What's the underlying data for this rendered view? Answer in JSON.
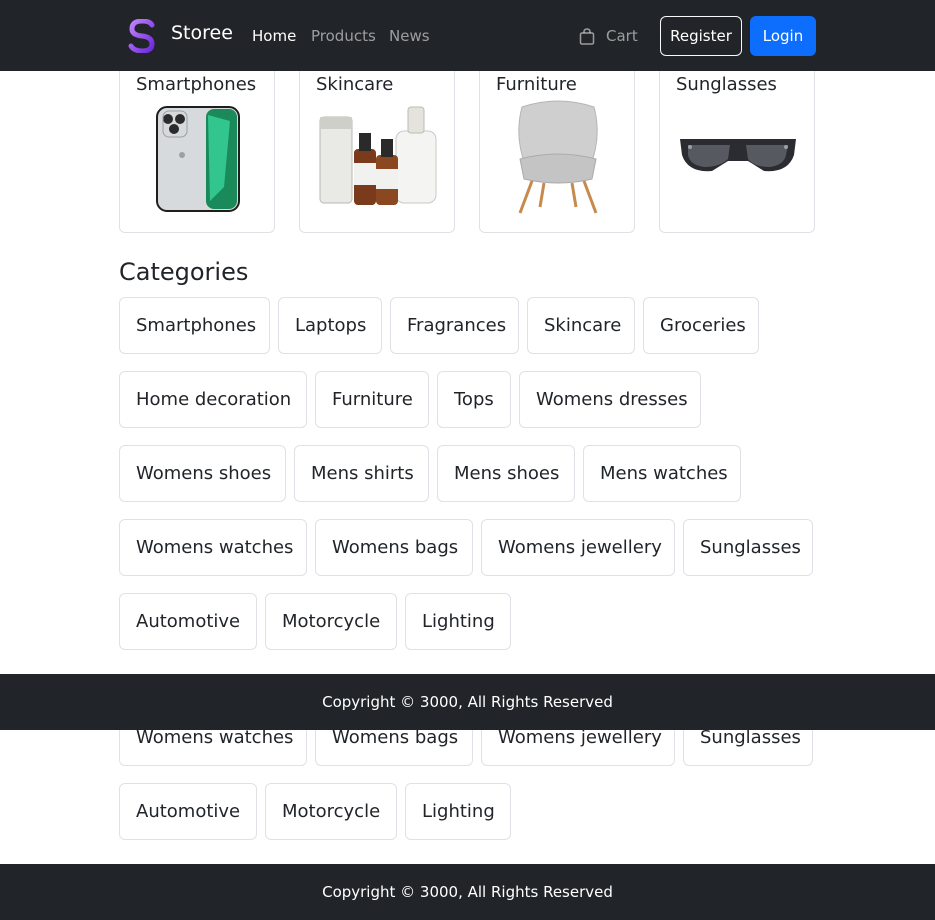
{
  "navbar": {
    "brand": "Storee",
    "links": [
      "Home",
      "Products",
      "News"
    ],
    "cart": "Cart",
    "register": "Register",
    "login": "Login",
    "colors": {
      "bg": "#212529",
      "primary": "#0d6efd",
      "brand_gradient": [
        "#a855f7",
        "#6d28d9"
      ]
    }
  },
  "products": [
    {
      "title": "Smartphones",
      "icon": "phone-image"
    },
    {
      "title": "Skincare",
      "icon": "skincare-bottles-image"
    },
    {
      "title": "Furniture",
      "icon": "chair-image"
    },
    {
      "title": "Sunglasses",
      "icon": "sunglasses-image"
    }
  ],
  "categories_title": "Categories",
  "categories": [
    "Smartphones",
    "Laptops",
    "Fragrances",
    "Skincare",
    "Groceries",
    "Home decoration",
    "Furniture",
    "Tops",
    "Womens dresses",
    "Womens shoes",
    "Mens shirts",
    "Mens shoes",
    "Mens watches",
    "Womens watches",
    "Womens bags",
    "Womens jewellery",
    "Sunglasses",
    "Automotive",
    "Motorcycle",
    "Lighting"
  ],
  "footer": {
    "text": "Copyright © 3000, All Rights Reserved"
  }
}
